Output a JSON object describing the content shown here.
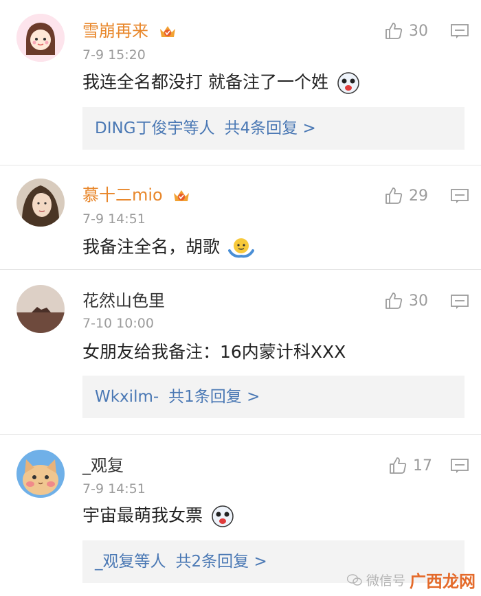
{
  "comments": [
    {
      "username": "雪崩再来",
      "time": "7-9 15:20",
      "text": "我连全名都没打 就备注了一个姓",
      "likes": "30",
      "reply": {
        "names": "DING丁俊宇等人",
        "count": "共4条回复 >"
      }
    },
    {
      "username": "慕十二mio",
      "time": "7-9 14:51",
      "text": "我备注全名，胡歌",
      "likes": "29"
    },
    {
      "username": "花然山色里",
      "time": "7-10 10:00",
      "text": "女朋友给我备注：16内蒙计科XXX",
      "likes": "30",
      "reply": {
        "names": "Wkxilm-",
        "count": "共1条回复 >"
      }
    },
    {
      "username": "_观复",
      "time": "7-9 14:51",
      "text": "宇宙最萌我女票",
      "likes": "17",
      "reply": {
        "names": "_观复等人",
        "count": "共2条回复 >"
      }
    }
  ],
  "watermark": {
    "label": "微信号",
    "site": "广西龙网"
  },
  "colors": {
    "username_vip": "#e8872b",
    "reply_link": "#4a78b4",
    "meta": "#9b9b9b",
    "reply_bg": "#f3f3f3"
  }
}
